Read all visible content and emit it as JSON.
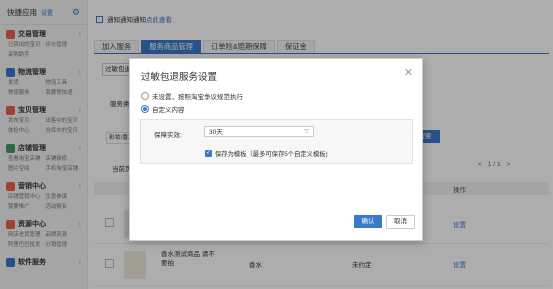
{
  "sidebar": {
    "title": "快捷应用",
    "settings_link": "设置",
    "sections": [
      {
        "title": "交易管理",
        "color": "#e8624a",
        "links": [
          "已卖出的宝贝",
          "评价管理",
          "采购助手"
        ]
      },
      {
        "title": "物流管理",
        "color": "#3a78c9",
        "links": [
          "发货",
          "物流工具",
          "物流服务",
          "我要寄快递"
        ]
      },
      {
        "title": "宝贝管理",
        "color": "#e8624a",
        "links": [
          "发布宝贝",
          "出售中的宝贝",
          "体检中心",
          "仓库中的宝贝"
        ]
      },
      {
        "title": "店铺管理",
        "color": "#3a9e5f",
        "links": [
          "查看淘宝店铺",
          "店铺装修",
          "图片空间",
          "手机淘宝店铺"
        ]
      },
      {
        "title": "营销中心",
        "color": "#e8624a",
        "links": [
          "店铺营销中心",
          "生意参谋",
          "我要推广",
          "活动报名"
        ]
      },
      {
        "title": "资源中心",
        "color": "#e8624a",
        "links": [
          "网店进货管理",
          "品牌资源",
          "阿里巴巴批发",
          "分销管理"
        ]
      },
      {
        "title": "软件服务",
        "color": "#3a78c9",
        "links": []
      }
    ]
  },
  "main": {
    "notice": {
      "text": "通知通知通知",
      "link": "点此查看"
    },
    "tabs": [
      {
        "label": "加入服务",
        "active": false
      },
      {
        "label": "服务商品管理",
        "active": true
      },
      {
        "label": "订单险&赔期保障",
        "active": false
      },
      {
        "label": "保证金",
        "active": false
      }
    ],
    "bg_dropdown": "过敏包退",
    "bg_service": "服务类",
    "bg_filter": "彩妆/香水",
    "bg_search_btn": "搜索",
    "bg_current_page": "当前页",
    "bg_pagination": "< 1/1 >",
    "table_header": {
      "action": "操作"
    },
    "rows": [
      {
        "name": "",
        "category": "",
        "status": "",
        "action": "设置"
      },
      {
        "name": "香水测试商品 请不要拍",
        "category": "香水",
        "status": "未约定",
        "action": "设置"
      }
    ]
  },
  "dialog": {
    "title": "过敏包退服务设置",
    "close_icon": "close-icon",
    "options": [
      {
        "label": "未设置，按照淘宝争议规范执行",
        "selected": false
      },
      {
        "label": "自定义内容",
        "selected": true
      }
    ],
    "period_label": "保障实效:",
    "period_value": "30天",
    "save_template": {
      "label": "保存为模板（最多可保存5个自定义模板)",
      "checked": true
    },
    "confirm_label": "确认",
    "cancel_label": "取消"
  }
}
